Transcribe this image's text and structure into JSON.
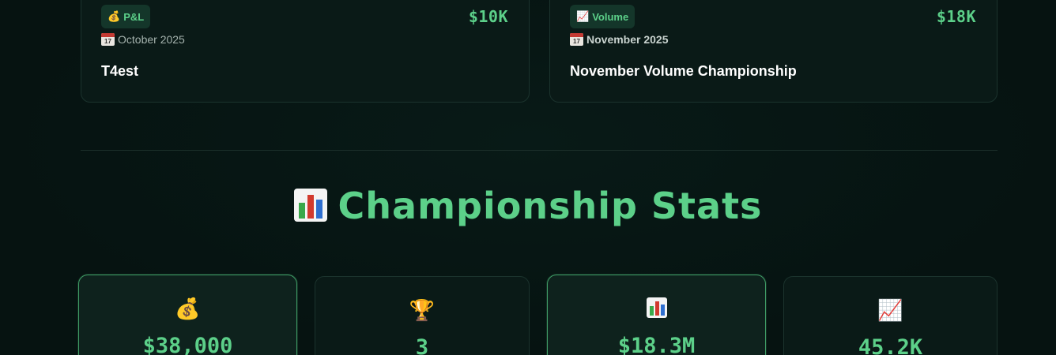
{
  "championships": [
    {
      "type_label": "P&L",
      "type_icon": "💰",
      "prize": "$10K",
      "date": "October 2025",
      "title": "T4est"
    },
    {
      "type_label": "Volume",
      "type_icon": "📈",
      "prize": "$18K",
      "date": "November 2025",
      "title": "November Volume Championship"
    }
  ],
  "calendar_day": "17",
  "stats_section": {
    "title": "Championship Stats",
    "icon": "bar-chart-icon"
  },
  "stats": [
    {
      "icon": "💰",
      "value": "$38,000"
    },
    {
      "icon": "🏆",
      "value": "3"
    },
    {
      "icon": "bar-chart-icon",
      "value": "$18.3M"
    },
    {
      "icon": "📈",
      "value": "45.2K"
    }
  ],
  "colors": {
    "accent": "#5cd089",
    "background": "#061311",
    "card": "#0a1a17",
    "card_border": "#1b332d",
    "highlight_border": "#3f9c66"
  }
}
